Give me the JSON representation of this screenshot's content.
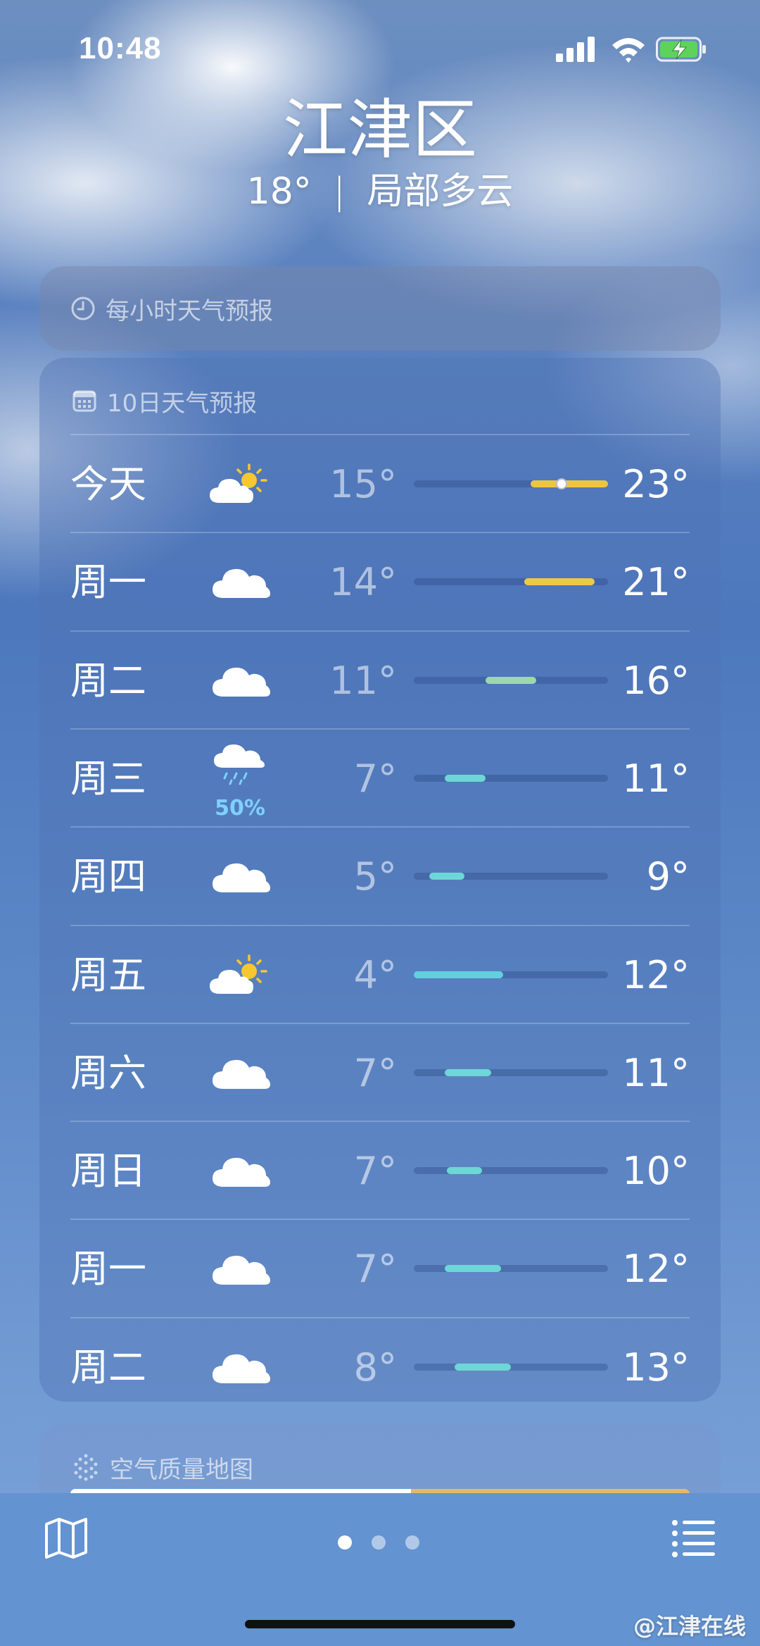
{
  "status_bar": {
    "time": "10:48"
  },
  "location": {
    "city": "江津区",
    "current_temp": "18°",
    "separator": "|",
    "condition": "局部多云"
  },
  "hourly_card": {
    "title": "每小时天气预报"
  },
  "daily_card": {
    "title": "10日天气预报",
    "days": [
      {
        "day": "今天",
        "icon": "partly-cloudy-icon",
        "low": "15°",
        "high": "23°",
        "bar_start": 0.6,
        "bar_end": 1.0,
        "color": "#f0c53e",
        "current_marker": 0.76,
        "precip": ""
      },
      {
        "day": "周一",
        "icon": "cloud-icon",
        "low": "14°",
        "high": "21°",
        "bar_start": 0.57,
        "bar_end": 0.93,
        "color": "#eec84a",
        "precip": ""
      },
      {
        "day": "周二",
        "icon": "cloud-icon",
        "low": "11°",
        "high": "16°",
        "bar_start": 0.37,
        "bar_end": 0.63,
        "color": "#9fd8a8",
        "precip": ""
      },
      {
        "day": "周三",
        "icon": "rain-cloud-icon",
        "low": "7°",
        "high": "11°",
        "bar_start": 0.16,
        "bar_end": 0.37,
        "color": "#6ed6d6",
        "precip": "50%"
      },
      {
        "day": "周四",
        "icon": "cloud-icon",
        "low": "5°",
        "high": "9°",
        "bar_start": 0.08,
        "bar_end": 0.26,
        "color": "#6ed6d6",
        "precip": ""
      },
      {
        "day": "周五",
        "icon": "partly-cloudy-icon",
        "low": "4°",
        "high": "12°",
        "bar_start": 0.0,
        "bar_end": 0.46,
        "color": "#62d0dd",
        "precip": ""
      },
      {
        "day": "周六",
        "icon": "cloud-icon",
        "low": "7°",
        "high": "11°",
        "bar_start": 0.16,
        "bar_end": 0.4,
        "color": "#6ed6d6",
        "precip": ""
      },
      {
        "day": "周日",
        "icon": "cloud-icon",
        "low": "7°",
        "high": "10°",
        "bar_start": 0.17,
        "bar_end": 0.35,
        "color": "#6ed6d6",
        "precip": ""
      },
      {
        "day": "周一",
        "icon": "cloud-icon",
        "low": "7°",
        "high": "12°",
        "bar_start": 0.16,
        "bar_end": 0.45,
        "color": "#6ed6d6",
        "precip": ""
      },
      {
        "day": "周二",
        "icon": "cloud-icon",
        "low": "8°",
        "high": "13°",
        "bar_start": 0.21,
        "bar_end": 0.5,
        "color": "#6ed6d6",
        "precip": ""
      }
    ]
  },
  "air_quality_card": {
    "title": "空气质量地图"
  },
  "bottom_bar": {
    "page_count": 3,
    "active_page": 0
  },
  "watermark": "@江津在线"
}
